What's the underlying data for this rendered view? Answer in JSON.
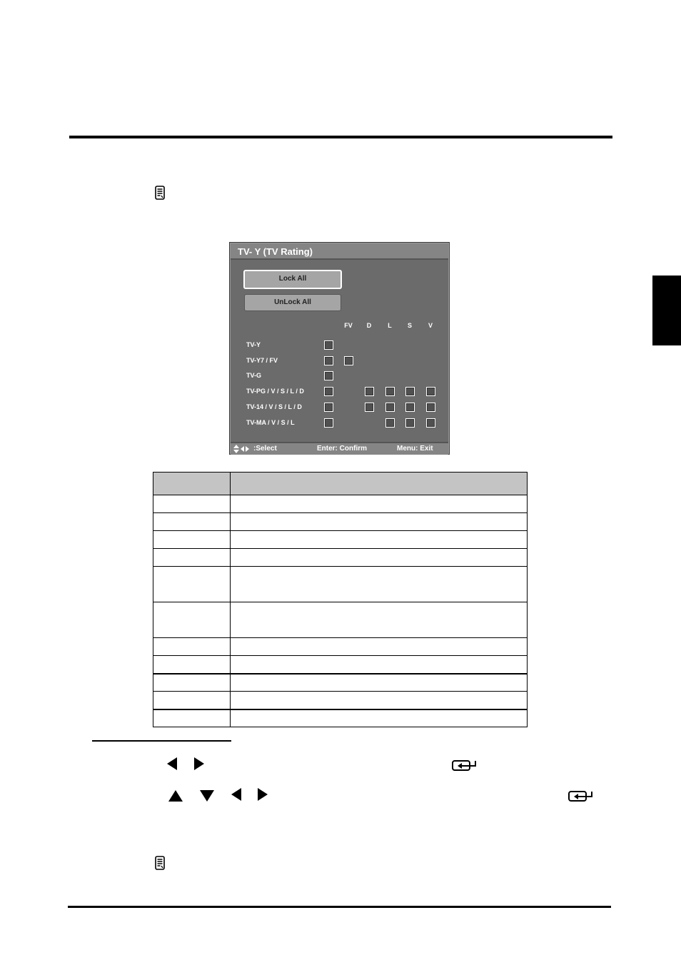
{
  "osd": {
    "title": "TV- Y (TV Rating)",
    "lock_all": "Lock All",
    "unlock_all": "UnLock All",
    "columns": [
      "FV",
      "D",
      "L",
      "S",
      "V"
    ],
    "rows": [
      {
        "label": "TV-Y",
        "boxes": [
          "main"
        ]
      },
      {
        "label": "TV-Y7 / FV",
        "boxes": [
          "main",
          "FV"
        ]
      },
      {
        "label": "TV-G",
        "boxes": [
          "main"
        ]
      },
      {
        "label": "TV-PG / V / S / L / D",
        "boxes": [
          "main",
          "D",
          "L",
          "S",
          "V"
        ]
      },
      {
        "label": "TV-14 / V / S / L / D",
        "boxes": [
          "main",
          "D",
          "L",
          "S",
          "V"
        ]
      },
      {
        "label": "TV-MA / V / S / L",
        "boxes": [
          "main",
          "L",
          "S",
          "V"
        ]
      }
    ],
    "footer": {
      "select": ":Select",
      "confirm": "Enter: Confirm",
      "exit": "Menu: Exit"
    }
  },
  "icons": [
    "note-icon",
    "arrow-left-icon",
    "arrow-right-icon",
    "arrow-up-icon",
    "arrow-down-icon",
    "enter-icon"
  ]
}
